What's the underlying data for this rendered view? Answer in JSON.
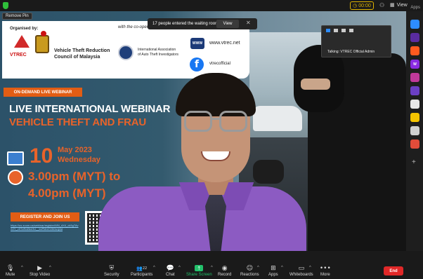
{
  "topbar": {
    "timer": "00:00",
    "view_label": "View",
    "apps_label": "Apps"
  },
  "stage": {
    "remove_pin": "Remove Pin",
    "notification": {
      "message": "17 people entered the waiting room",
      "view_button": "View",
      "close": "✕"
    },
    "mini_tile": {
      "talking": "Talking: VTREC Official Admin"
    }
  },
  "slide": {
    "organised_by": "Organised by:",
    "cooperation": "with the co-operation of:",
    "vtrec_logo_text": "VTREC",
    "council_name_1": "Vehicle Theft Reduction",
    "council_name_2": "Council of Malaysia",
    "iaati_1": "International Association",
    "iaati_2": "of Auto Theft Investigators",
    "www_icon": "WWW",
    "website": "www.vtrec.net",
    "facebook_icon": "f",
    "facebook": "vtrecofficial",
    "ondemand": "ON-DEMAND LIVE WEBINAR",
    "live_title": "LIVE INTERNATIONAL WEBINAR",
    "topic": "VEHICLE THEFT AND FRAU",
    "day": "10",
    "month": "May 2023",
    "weekday": "Wednesday",
    "time_start": "3.00pm (MYT) to",
    "time_end": "4.00pm (MYT)",
    "register": "REGISTER AND JOIN US",
    "register_link": "https://us.zoom.us/webinar/register/WN_dX4_ck5gTAvX2Y_v5TzRdZbcHU__kvPMmTZ8Gs1jAd"
  },
  "rail_apps": [
    {
      "name": "zoom-app-1",
      "color": "#2d8cff",
      "label": ""
    },
    {
      "name": "miro-app",
      "color": "#5a2ca0",
      "label": ""
    },
    {
      "name": "app-orange",
      "color": "#ff5a1f",
      "label": ""
    },
    {
      "name": "app-w",
      "color": "#8a2be2",
      "label": "W"
    },
    {
      "name": "app-pink",
      "color": "#c0399a",
      "label": ""
    },
    {
      "name": "app-purple",
      "color": "#6b3fc4",
      "label": ""
    },
    {
      "name": "app-white",
      "color": "#e8e8e8",
      "label": ""
    },
    {
      "name": "app-yellow",
      "color": "#f5c400",
      "label": ""
    },
    {
      "name": "app-gray",
      "color": "#d0d0d0",
      "label": ""
    },
    {
      "name": "app-multicolor",
      "color": "#e24c3a",
      "label": ""
    }
  ],
  "toolbar": {
    "mute": "Mute",
    "stop_video": "Stop Video",
    "security": "Security",
    "participants": "Participants",
    "participants_count": "22",
    "chat": "Chat",
    "share_screen": "Share Screen",
    "record": "Record",
    "reactions": "Reactions",
    "apps": "Apps",
    "whiteboards": "Whiteboards",
    "more": "More",
    "end": "End"
  },
  "colors": {
    "accent_orange": "#e8632a",
    "share_green": "#23c16b",
    "end_red": "#e02828",
    "timer_yellow": "#e0b400"
  }
}
